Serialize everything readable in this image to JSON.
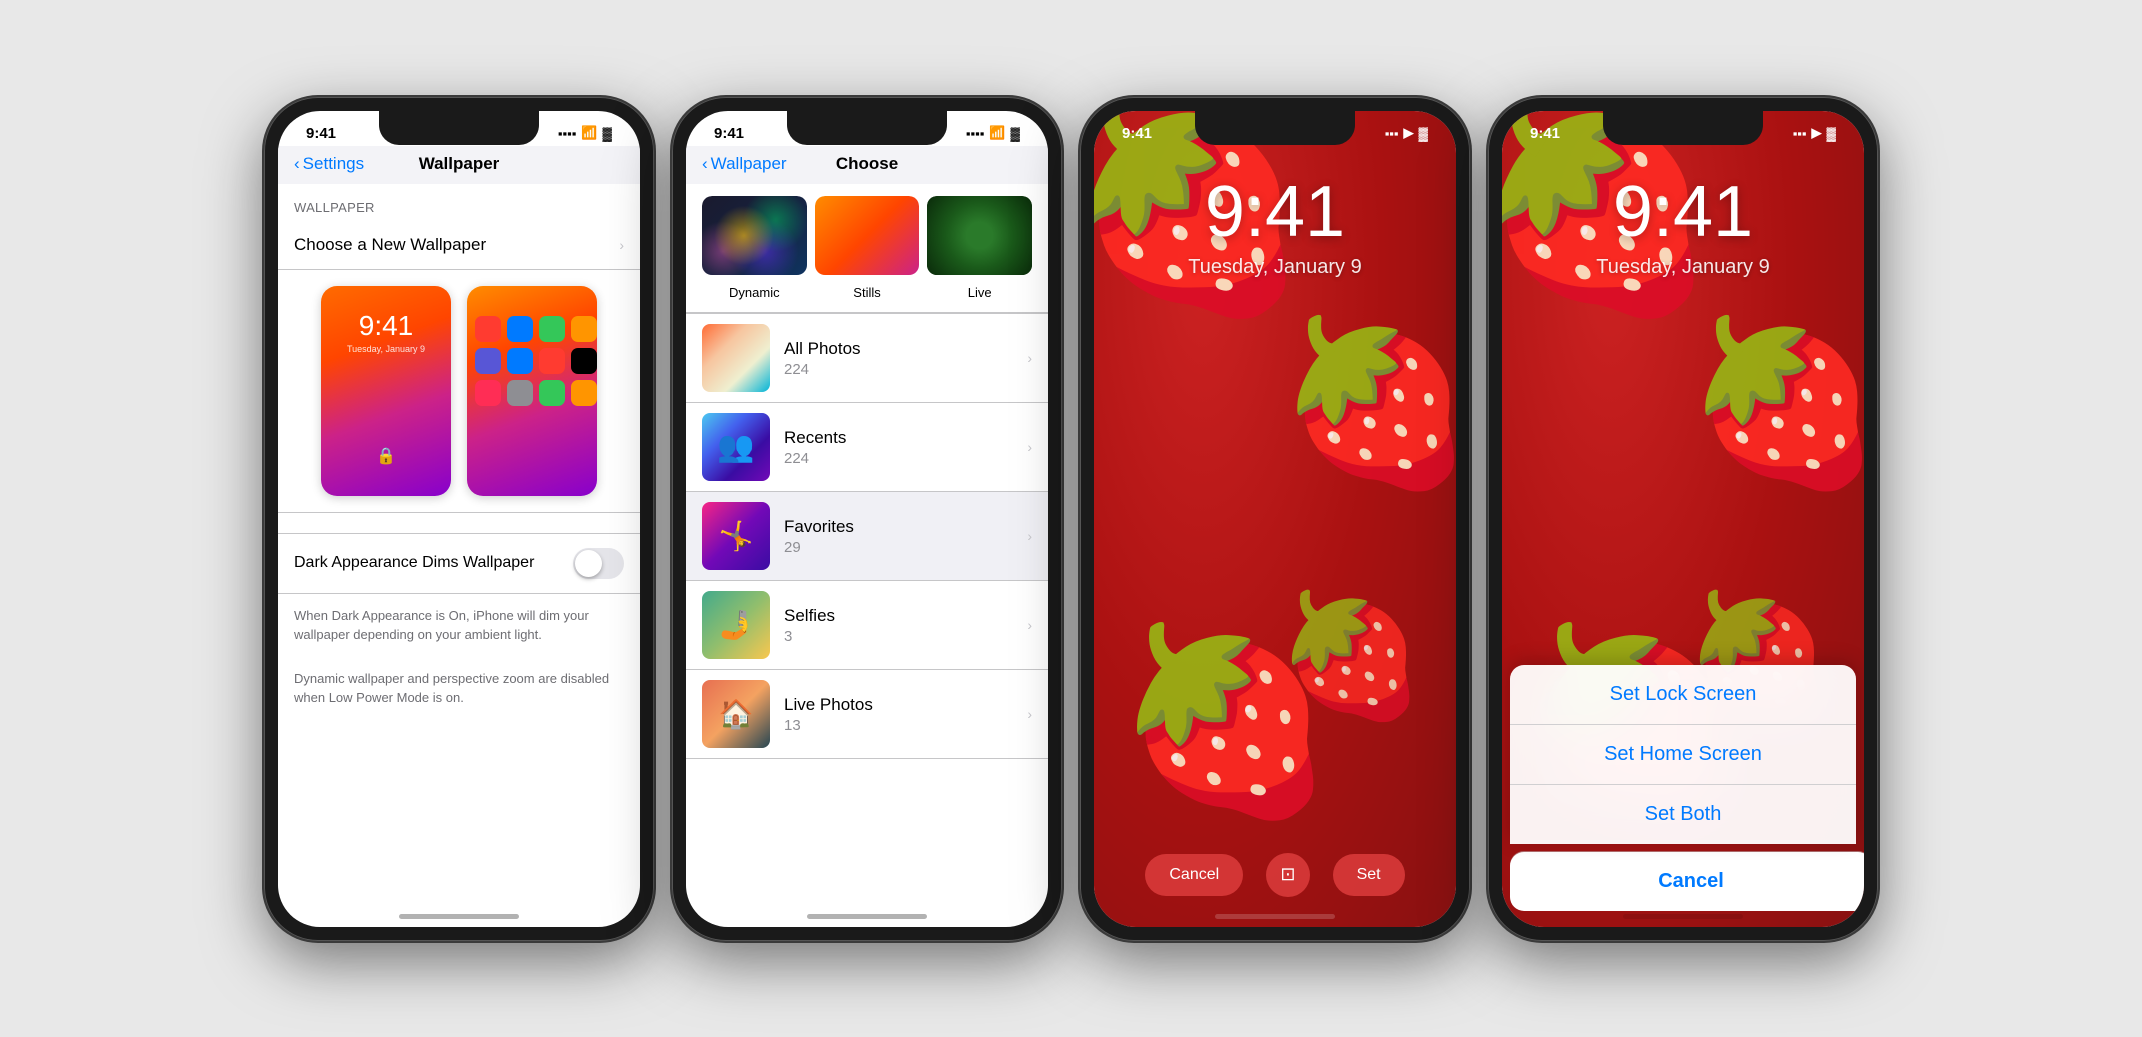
{
  "phones": [
    {
      "id": "wallpaper-settings",
      "statusBar": {
        "time": "9:41",
        "signal": true,
        "wifi": true,
        "battery": true
      },
      "nav": {
        "backLabel": "Settings",
        "title": "Wallpaper"
      },
      "sectionLabel": "WALLPAPER",
      "chooseRow": {
        "label": "Choose a New Wallpaper"
      },
      "lockTime": "9:41",
      "lockDate": "Tuesday, January 9",
      "toggleRow": {
        "label": "Dark Appearance Dims Wallpaper"
      },
      "description1": "When Dark Appearance is On, iPhone will dim your wallpaper depending on your ambient light.",
      "description2": "Dynamic wallpaper and perspective zoom are disabled when Low Power Mode is on."
    },
    {
      "id": "choose-wallpaper",
      "statusBar": {
        "time": "9:41"
      },
      "nav": {
        "backLabel": "Wallpaper",
        "title": "Choose"
      },
      "categories": [
        {
          "label": "Dynamic",
          "type": "dynamic"
        },
        {
          "label": "Stills",
          "type": "stills"
        },
        {
          "label": "Live",
          "type": "live"
        }
      ],
      "photoAlbums": [
        {
          "name": "All Photos",
          "count": "224",
          "type": "all"
        },
        {
          "name": "Recents",
          "count": "224",
          "type": "recents"
        },
        {
          "name": "Favorites",
          "count": "29",
          "type": "favorites",
          "selected": true
        },
        {
          "name": "Selfies",
          "count": "3",
          "type": "selfies"
        },
        {
          "name": "Live Photos",
          "count": "13",
          "type": "live"
        }
      ]
    },
    {
      "id": "lock-screen-preview",
      "statusBar": {
        "time": "9:41"
      },
      "time": "9:41",
      "date": "Tuesday, January 9",
      "cancelBtn": "Cancel",
      "setBtn": "Set"
    },
    {
      "id": "set-wallpaper-options",
      "statusBar": {
        "time": "9:41"
      },
      "time": "9:41",
      "date": "Tuesday, January 9",
      "options": [
        "Set Lock Screen",
        "Set Home Screen",
        "Set Both"
      ],
      "cancelLabel": "Cancel"
    }
  ]
}
